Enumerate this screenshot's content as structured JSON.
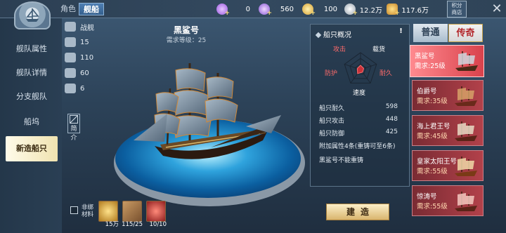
{
  "top": {
    "tabs": [
      {
        "label": "角色"
      },
      {
        "label": "舰船"
      }
    ],
    "resources": [
      {
        "name": "purple-diamond",
        "value": "0"
      },
      {
        "name": "blue-diamond",
        "value": "560"
      },
      {
        "name": "gold-coin",
        "value": "100"
      },
      {
        "name": "silver-coin",
        "value": "12.2万"
      },
      {
        "name": "gold-ingot",
        "value": "117.6万"
      }
    ],
    "shop_label": [
      "积分",
      "商店"
    ],
    "close": "✕"
  },
  "nav": {
    "items": [
      {
        "label": "舰队属性"
      },
      {
        "label": "舰队详情"
      },
      {
        "label": "分支舰队"
      },
      {
        "label": "船坞"
      },
      {
        "label": "新造船只"
      }
    ],
    "active_index": 4
  },
  "stats": [
    {
      "icon": "warship-icon",
      "value": "战舰"
    },
    {
      "icon": "cannon-icon",
      "value": "15"
    },
    {
      "icon": "sail-icon",
      "value": "110"
    },
    {
      "icon": "crew-icon",
      "value": "60"
    },
    {
      "icon": "cargo-icon",
      "value": "6"
    }
  ],
  "intro_label": "简介",
  "ship": {
    "name": "黑鲨号",
    "level_req": "需求等级：25"
  },
  "overview": {
    "title": "船只概况",
    "help": "!",
    "radar": {
      "labels": [
        "攻击",
        "载货",
        "耐久",
        "速度",
        "防护"
      ],
      "values": [
        0.25,
        0.2,
        0.2,
        0.3,
        0.2
      ],
      "colors": {
        "攻击": "#ff6b6b",
        "载货": "#ffffff",
        "耐久": "#ff6b6b",
        "速度": "#ffffff",
        "防护": "#ff6b6b"
      }
    },
    "rows": [
      {
        "key": "船只耐久",
        "value": "598"
      },
      {
        "key": "船只攻击",
        "value": "448"
      },
      {
        "key": "船只防御",
        "value": "425"
      }
    ],
    "notes": [
      "附加属性4条(重铸可至6条)",
      "黑鲨号不能重铸"
    ]
  },
  "modes": {
    "normal": "普通",
    "legend": "传奇"
  },
  "ships": [
    {
      "name": "黑鲨号",
      "req": "需求:25级",
      "active": true
    },
    {
      "name": "伯爵号",
      "req": "需求:35级",
      "active": false
    },
    {
      "name": "海上君王号",
      "req": "需求:45级",
      "active": false
    },
    {
      "name": "皇家太阳王号",
      "req": "需求:55级",
      "active": false
    },
    {
      "name": "惊涛号",
      "req": "需求:55级",
      "active": false
    }
  ],
  "materials": {
    "unbound_label": "非绑材料",
    "items": [
      {
        "icon": "gold-coin-pile-icon",
        "count": "15万"
      },
      {
        "icon": "wood-plank-icon",
        "count": "115/25"
      },
      {
        "icon": "red-gem-icon",
        "count": "10/10"
      }
    ]
  },
  "build_label": "建造"
}
